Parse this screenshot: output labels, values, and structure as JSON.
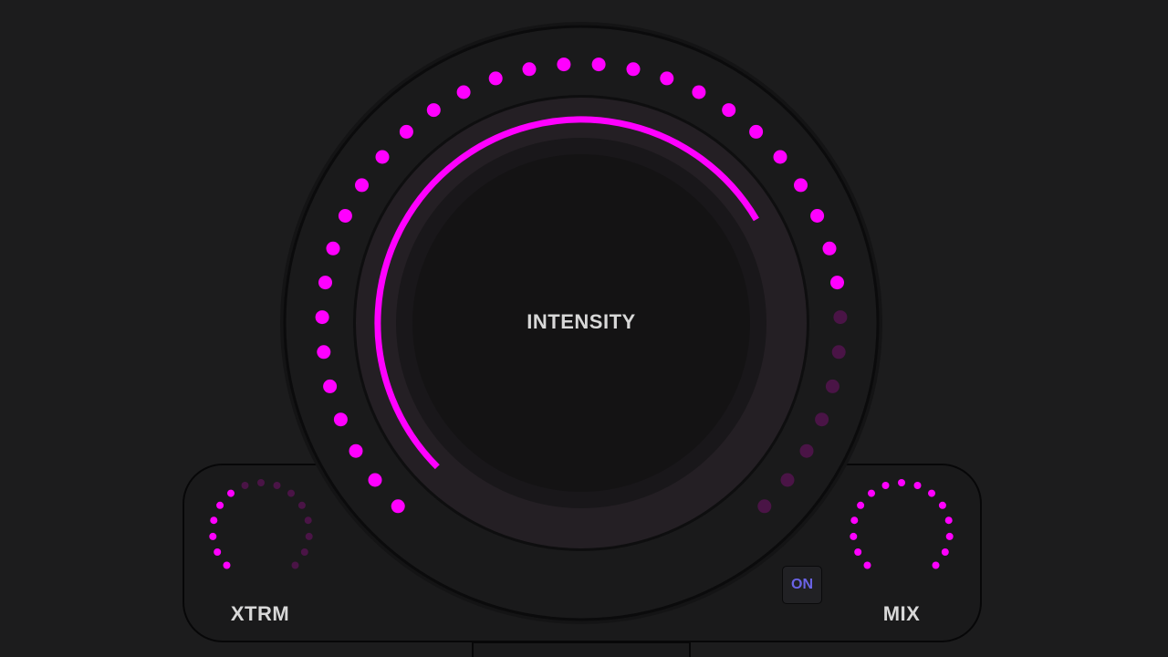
{
  "colors": {
    "accent": "#ff00ff",
    "accent_dim": "#4a1446",
    "on_text": "#6a63e6"
  },
  "intensity_knob": {
    "label": "INTENSITY",
    "value_fraction": 0.72,
    "led_count": 36,
    "leds_lit": 29
  },
  "xtrm_knob": {
    "label": "XTRM",
    "value_fraction": 0.4,
    "led_count": 15,
    "leds_lit": 6
  },
  "mix_knob": {
    "label": "MIX",
    "value_fraction": 1.0,
    "led_count": 15,
    "leds_lit": 15
  },
  "on_button": {
    "label": "ON"
  }
}
